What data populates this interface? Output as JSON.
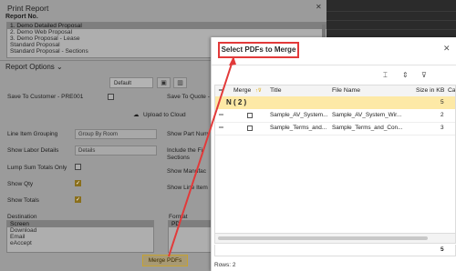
{
  "print_report": {
    "title": "Print Report",
    "close": "✕",
    "report_no_label": "Report No.",
    "reports": [
      {
        "label": "1. Demo Detailed Proposal",
        "selected": true
      },
      {
        "label": "2. Demo Web Proposal",
        "selected": false
      },
      {
        "label": "3. Demo Proposal - Lease",
        "selected": false
      },
      {
        "label": "Standard Proposal",
        "selected": false
      },
      {
        "label": "Standard Proposal - Sections",
        "selected": false
      }
    ],
    "report_options_label": "Report Options ⌄",
    "template_value": "Default",
    "save_to_customer_label": "Save To Customer - PRE001",
    "save_to_quote_label": "Save To Quote -",
    "upload_to_cloud_label": "Upload to Cloud",
    "line_item_grouping_label": "Line Item Grouping",
    "line_item_grouping_value": "Group By Room",
    "show_labor_details_label": "Show Labor Details",
    "show_labor_details_value": "Details",
    "lump_sum_totals_only_label": "Lump Sum Totals Only",
    "show_qty_label": "Show Qty",
    "show_totals_label": "Show Totals",
    "show_part_number_label": "Show Part Num",
    "include_fine_sections_label1": "Include the Fi",
    "include_fine_sections_label2": "Sections",
    "show_manufacturer_label": "Show Manufac",
    "show_line_item_label": "Show Line Item",
    "destination_label": "Destination",
    "destinations": [
      "Screen",
      "Download",
      "Email",
      "eAccept"
    ],
    "format_label": "Format",
    "format_value": "PD",
    "merge_pdfs_label": "Merge PDFs"
  },
  "modal": {
    "title": "Select PDFs to Merge",
    "close": "✕",
    "toolbar": {
      "fit_columns": "⌶",
      "expand": "⇕",
      "filter": "⊽"
    },
    "columns": [
      "Merge",
      "Title",
      "File Name",
      "Size in KB",
      "Ca"
    ],
    "merge_sort_indicator": "↑⊽",
    "group": {
      "label": "N ( 2 )",
      "count": "5"
    },
    "rows": [
      {
        "title": "Sample_AV_System...",
        "file_name": "Sample_AV_System_Wir...",
        "size": "2"
      },
      {
        "title": "Sample_Terms_and...",
        "file_name": "Sample_Terms_and_Con...",
        "size": "3"
      }
    ],
    "footer_total": "5",
    "rows_count": "Rows: 2"
  },
  "colors": {
    "annotation": "#e23a3a",
    "group_highlight": "#fde9a6",
    "merge_button_border": "#c5a232"
  }
}
